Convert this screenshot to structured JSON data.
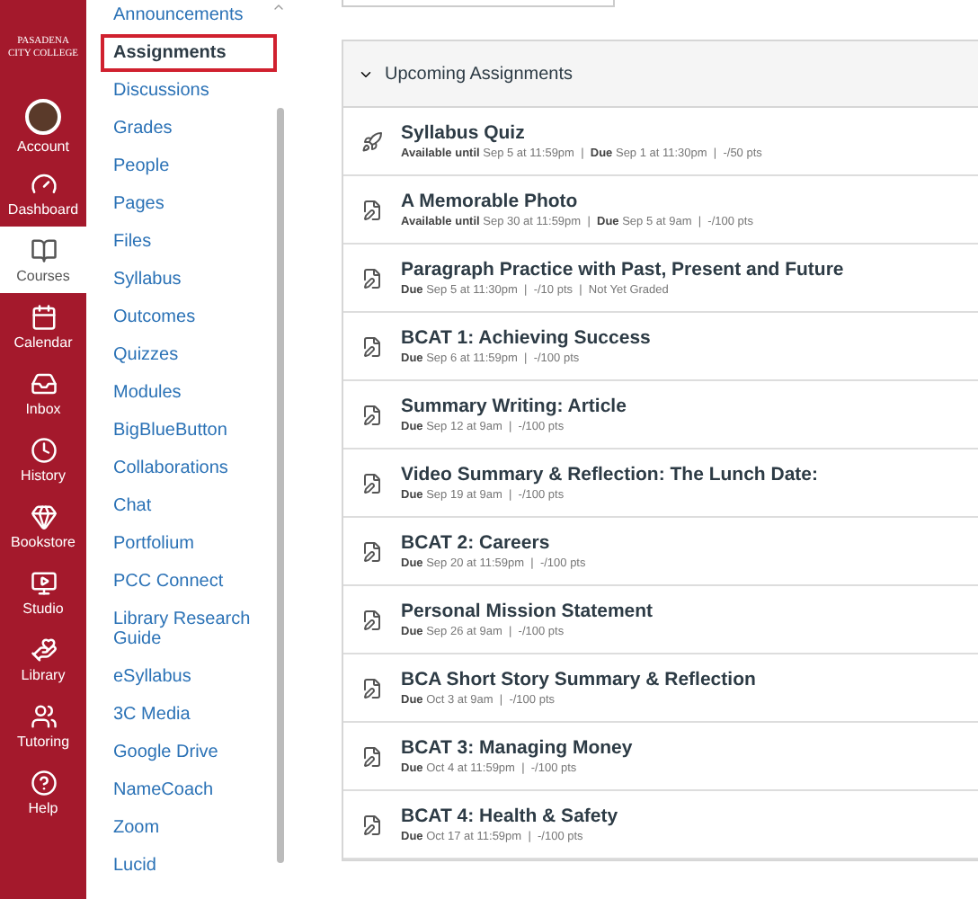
{
  "global_nav": {
    "logo": [
      "PASADENA",
      "CITY COLLEGE"
    ],
    "items": [
      {
        "label": "Account",
        "kind": "avatar",
        "selected": false
      },
      {
        "label": "Dashboard",
        "kind": "dashboard",
        "selected": false
      },
      {
        "label": "Courses",
        "kind": "courses",
        "selected": true
      },
      {
        "label": "Calendar",
        "kind": "calendar",
        "selected": false
      },
      {
        "label": "Inbox",
        "kind": "inbox",
        "selected": false
      },
      {
        "label": "History",
        "kind": "history",
        "selected": false
      },
      {
        "label": "Bookstore",
        "kind": "bookstore",
        "selected": false
      },
      {
        "label": "Studio",
        "kind": "studio",
        "selected": false
      },
      {
        "label": "Library",
        "kind": "library",
        "selected": false
      },
      {
        "label": "Tutoring",
        "kind": "tutoring",
        "selected": false
      },
      {
        "label": "Help",
        "kind": "help",
        "selected": false
      }
    ]
  },
  "course_nav": {
    "items": [
      {
        "label": "Announcements",
        "selected": false
      },
      {
        "label": "Assignments",
        "selected": true
      },
      {
        "label": "Discussions",
        "selected": false
      },
      {
        "label": "Grades",
        "selected": false
      },
      {
        "label": "People",
        "selected": false
      },
      {
        "label": "Pages",
        "selected": false
      },
      {
        "label": "Files",
        "selected": false
      },
      {
        "label": "Syllabus",
        "selected": false
      },
      {
        "label": "Outcomes",
        "selected": false
      },
      {
        "label": "Quizzes",
        "selected": false
      },
      {
        "label": "Modules",
        "selected": false
      },
      {
        "label": "BigBlueButton",
        "selected": false
      },
      {
        "label": "Collaborations",
        "selected": false
      },
      {
        "label": "Chat",
        "selected": false
      },
      {
        "label": "Portfolium",
        "selected": false
      },
      {
        "label": "PCC Connect",
        "selected": false
      },
      {
        "label": "Library Research Guide",
        "selected": false
      },
      {
        "label": "eSyllabus",
        "selected": false
      },
      {
        "label": "3C Media",
        "selected": false
      },
      {
        "label": "Google Drive",
        "selected": false
      },
      {
        "label": "NameCoach",
        "selected": false
      },
      {
        "label": "Zoom",
        "selected": false
      },
      {
        "label": "Lucid",
        "selected": false
      }
    ]
  },
  "assignments": {
    "group_title": "Upcoming Assignments",
    "expanded": true,
    "rows": [
      {
        "kind": "quiz",
        "title": "Syllabus Quiz",
        "meta": "**Available until** Sep 5 at 11:59pm  |  **Due** Sep 1 at 11:30pm  |  -/50 pts"
      },
      {
        "kind": "assignment",
        "title": "A Memorable Photo",
        "meta": "**Available until** Sep 30 at 11:59pm  |  **Due** Sep 5 at 9am  |  -/100 pts"
      },
      {
        "kind": "assignment",
        "title": "Paragraph Practice with Past, Present and Future",
        "meta": "**Due** Sep 5 at 11:30pm  |  -/10 pts  |  Not Yet Graded"
      },
      {
        "kind": "assignment",
        "title": "BCAT 1: Achieving Success",
        "meta": "**Due** Sep 6 at 11:59pm  |  -/100 pts"
      },
      {
        "kind": "assignment",
        "title": "Summary Writing: Article",
        "meta": "**Due** Sep 12 at 9am  |  -/100 pts"
      },
      {
        "kind": "assignment",
        "title": "Video Summary & Reflection: The Lunch Date:",
        "meta": "**Due** Sep 19 at 9am  |  -/100 pts"
      },
      {
        "kind": "assignment",
        "title": "BCAT 2: Careers",
        "meta": "**Due** Sep 20 at 11:59pm  |  -/100 pts"
      },
      {
        "kind": "assignment",
        "title": "Personal Mission Statement",
        "meta": "**Due** Sep 26 at 9am  |  -/100 pts"
      },
      {
        "kind": "assignment",
        "title": "BCA Short Story Summary & Reflection",
        "meta": "**Due** Oct 3 at 9am  |  -/100 pts"
      },
      {
        "kind": "assignment",
        "title": "BCAT 3: Managing Money",
        "meta": "**Due** Oct 4 at 11:59pm  |  -/100 pts"
      },
      {
        "kind": "assignment",
        "title": "BCAT 4: Health & Safety",
        "meta": "**Due** Oct 17 at 11:59pm  |  -/100 pts"
      }
    ]
  }
}
